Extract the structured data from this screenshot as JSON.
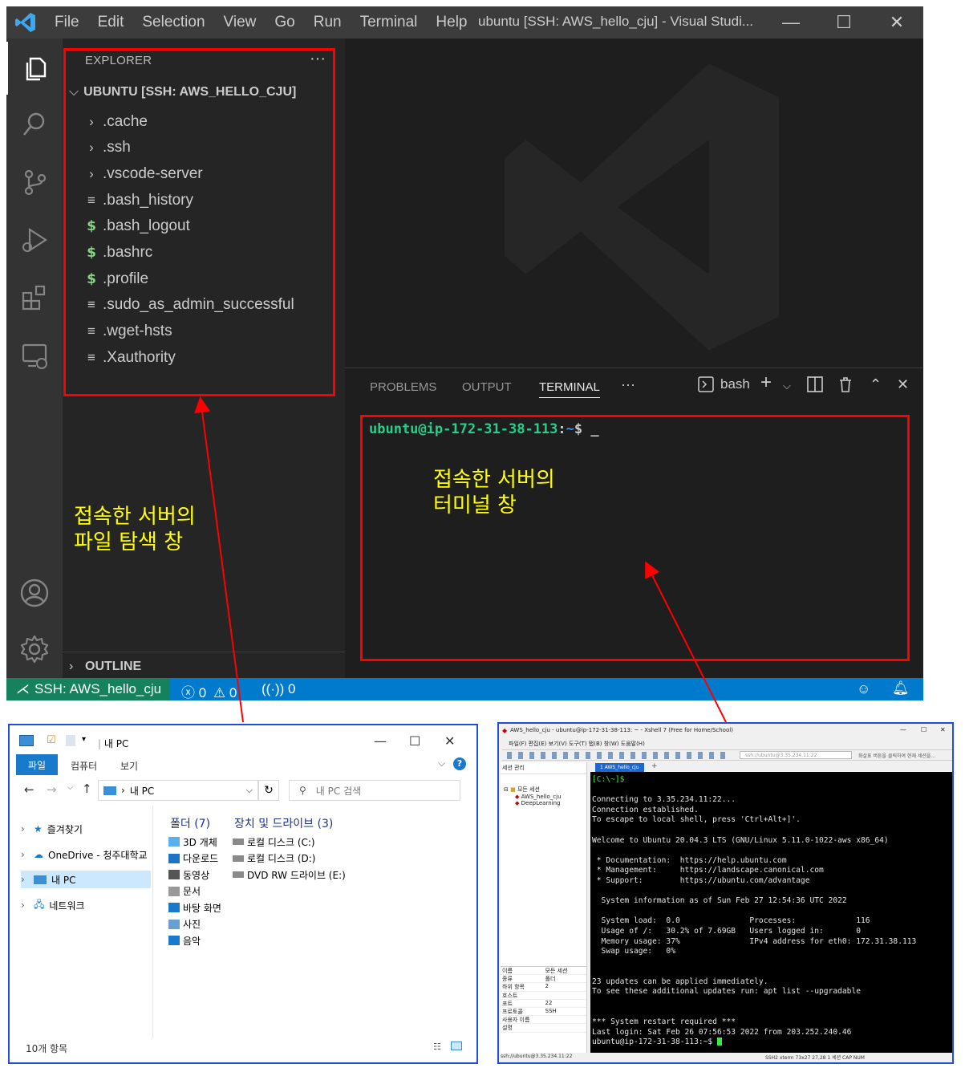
{
  "vscode": {
    "title_menu": [
      "File",
      "Edit",
      "Selection",
      "View",
      "Go",
      "Run",
      "Terminal",
      "Help"
    ],
    "window_title": "ubuntu [SSH: AWS_hello_cju] - Visual Studi...",
    "window_controls": {
      "minimize": "—",
      "maximize": "☐",
      "close": "✕"
    },
    "activity_icons": [
      "explorer-icon",
      "search-icon",
      "source-control-icon",
      "run-debug-icon",
      "extensions-icon",
      "remote-explorer-icon",
      "account-icon",
      "gear-icon"
    ],
    "sidebar": {
      "header": "EXPLORER",
      "more": "···",
      "root": "UBUNTU [SSH: AWS_HELLO_CJU]",
      "items": [
        {
          "type": "folder",
          "icon": "›",
          "label": ".cache"
        },
        {
          "type": "folder",
          "icon": "›",
          "label": ".ssh"
        },
        {
          "type": "folder",
          "icon": "›",
          "label": ".vscode-server"
        },
        {
          "type": "text",
          "icon": "≡",
          "label": ".bash_history"
        },
        {
          "type": "shell",
          "icon": "$",
          "label": ".bash_logout"
        },
        {
          "type": "shell",
          "icon": "$",
          "label": ".bashrc"
        },
        {
          "type": "shell",
          "icon": "$",
          "label": ".profile"
        },
        {
          "type": "text",
          "icon": "≡",
          "label": ".sudo_as_admin_successful"
        },
        {
          "type": "text",
          "icon": "≡",
          "label": ".wget-hsts"
        },
        {
          "type": "text",
          "icon": "≡",
          "label": ".Xauthority"
        }
      ],
      "outline": "OUTLINE"
    },
    "panel": {
      "tabs": [
        "PROBLEMS",
        "OUTPUT",
        "TERMINAL"
      ],
      "active_tab": "TERMINAL",
      "more": "···",
      "shell": "bash",
      "prompt_user": "ubuntu@ip-172-31-38-113",
      "prompt_sep": ":",
      "prompt_path": "~",
      "prompt_dollar": "$ _"
    },
    "statusbar": {
      "remote": "SSH: AWS_hello_cju",
      "errors": "0",
      "warnings": "0",
      "ports": "0"
    }
  },
  "annotations": {
    "explorer_note": "접속한 서버의\n파일 탐색 창",
    "terminal_note": "접속한 서버의\n터미널 창",
    "color": "#ff0000",
    "note_color": "#ffff00"
  },
  "win_explorer": {
    "title": "내 PC",
    "ribbon_tabs": [
      "파일",
      "컴퓨터",
      "보기"
    ],
    "address": "내 PC",
    "search_placeholder": "내 PC 검색",
    "nav": [
      "즐겨찾기",
      "OneDrive - 청주대학교",
      "내 PC",
      "네트워크"
    ],
    "folders_header": "폴더 (7)",
    "drives_header": "장치 및 드라이브 (3)",
    "folders": [
      "3D 개체",
      "다운로드",
      "동영상",
      "문서",
      "바탕 화면",
      "사진",
      "음악"
    ],
    "drives": [
      "로컬 디스크 (C:)",
      "로컬 디스크 (D:)",
      "DVD RW 드라이브 (E:)"
    ],
    "status": "10개 항목"
  },
  "xshell": {
    "title": "AWS_hello_cju - ubuntu@ip-172-31-38-113: ~ - Xshell 7 (Free for Home/School)",
    "menu": "파일(F)   편집(E)   보기(V)   도구(T)   탭(B)   창(W)   도움말(H)",
    "address": "ssh://ubuntu@3.35.234.11:22",
    "hint": "화살표 버튼을 클릭하여 현재 세션을...",
    "session_header": "세션 관리",
    "sessions": [
      "모든 세션",
      "AWS_hello_cju",
      "DeepLearning"
    ],
    "tab": "1 AWS_hello_cju",
    "props": [
      [
        "이름",
        "모든 세션"
      ],
      [
        "종류",
        "폴더"
      ],
      [
        "하위 항목",
        "2"
      ],
      [
        "호스트",
        ""
      ],
      [
        "포트",
        "22"
      ],
      [
        "프로토콜",
        "SSH"
      ],
      [
        "사용자 이름",
        ""
      ],
      [
        "설명",
        ""
      ]
    ],
    "terminal_lines": [
      "[C:\\~]$",
      "",
      "Connecting to 3.35.234.11:22...",
      "Connection established.",
      "To escape to local shell, press 'Ctrl+Alt+]'.",
      "",
      "Welcome to Ubuntu 20.04.3 LTS (GNU/Linux 5.11.0-1022-aws x86_64)",
      "",
      " * Documentation:  https://help.ubuntu.com",
      " * Management:     https://landscape.canonical.com",
      " * Support:        https://ubuntu.com/advantage",
      "",
      "  System information as of Sun Feb 27 12:54:36 UTC 2022",
      "",
      "  System load:  0.0               Processes:             116",
      "  Usage of /:   30.2% of 7.69GB   Users logged in:       0",
      "  Memory usage: 37%               IPv4 address for eth0: 172.31.38.113",
      "  Swap usage:   0%",
      "",
      "",
      "23 updates can be applied immediately.",
      "To see these additional updates run: apt list --upgradable",
      "",
      "",
      "*** System restart required ***",
      "Last login: Sat Feb 26 07:56:53 2022 from 203.252.240.46",
      "ubuntu@ip-172-31-38-113:~$ "
    ],
    "status_left": "ssh://ubuntu@3.35.234.11:22",
    "status_right": "SSH2    xterm    73x27    27,28    1 세션    CAP  NUM"
  }
}
